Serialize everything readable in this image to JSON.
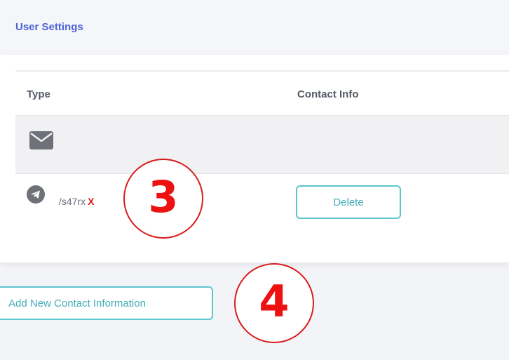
{
  "header": {
    "title": "User Settings"
  },
  "table": {
    "columns": [
      "Type",
      "Contact Info"
    ],
    "rows": [
      {
        "type_icon": "envelope-icon",
        "contact": ""
      },
      {
        "type_icon": "telegram-icon",
        "handle": "/s47rx",
        "handle_mark": "X",
        "action_label": "Delete"
      }
    ]
  },
  "actions": {
    "add_label": "Add New Contact Information"
  },
  "annotations": [
    "3",
    "4"
  ],
  "colors": {
    "title": "#4a63d8",
    "accent": "#5bc6cf",
    "annotation": "#d71c1c"
  }
}
